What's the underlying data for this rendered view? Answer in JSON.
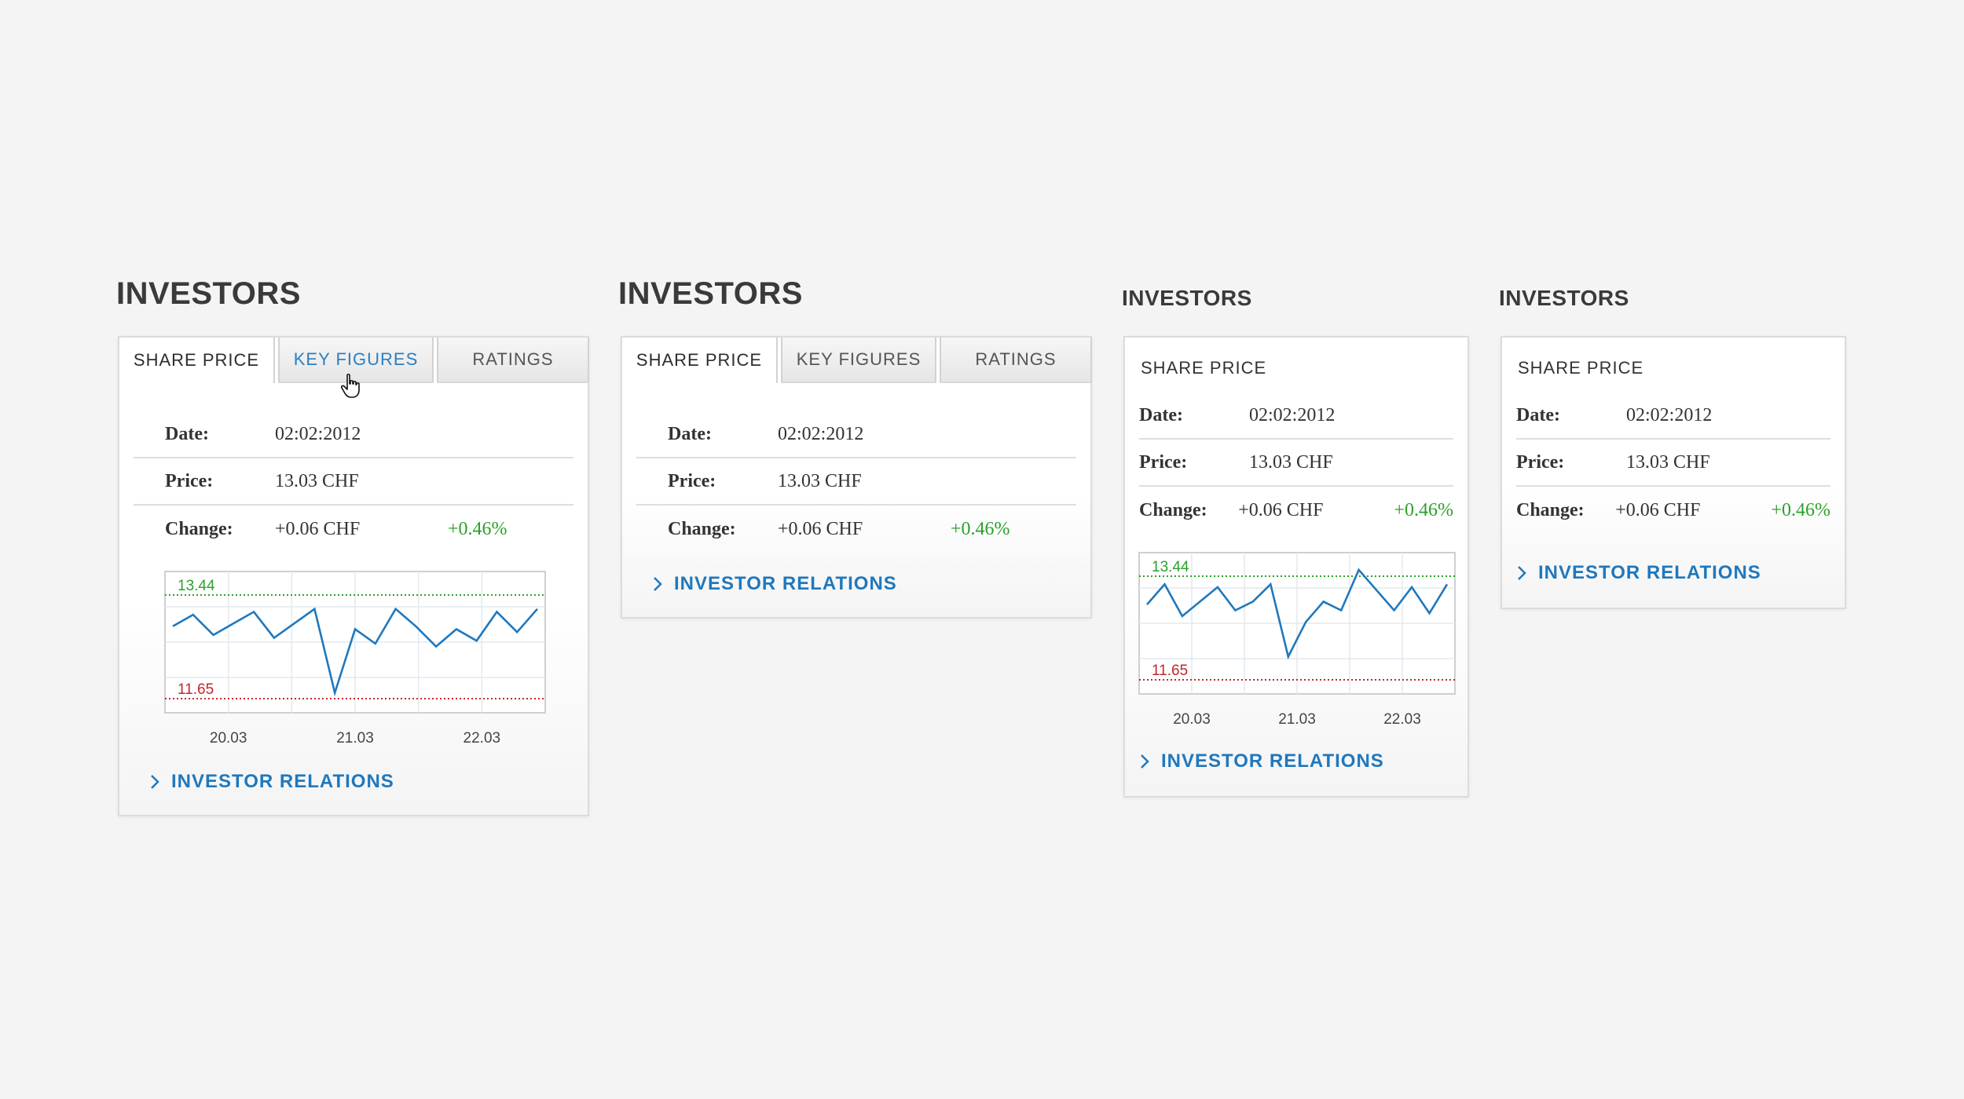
{
  "widgets": [
    {
      "heading": "INVESTORS",
      "tabs": [
        "SHARE PRICE",
        "KEY FIGURES",
        "RATINGS"
      ],
      "rows": [
        {
          "label": "Date:",
          "value": "02:02:2012"
        },
        {
          "label": "Price:",
          "value": "13.03 CHF"
        },
        {
          "label": "Change:",
          "value": "+0.06 CHF",
          "percent": "+0.46%"
        }
      ],
      "link": "INVESTOR RELATIONS"
    },
    {
      "heading": "INVESTORS",
      "tabs": [
        "SHARE PRICE",
        "KEY FIGURES",
        "RATINGS"
      ],
      "rows": [
        {
          "label": "Date:",
          "value": "02:02:2012"
        },
        {
          "label": "Price:",
          "value": "13.03 CHF"
        },
        {
          "label": "Change:",
          "value": "+0.06 CHF",
          "percent": "+0.46%"
        }
      ],
      "link": "INVESTOR RELATIONS"
    },
    {
      "heading": "INVESTORS",
      "title": "SHARE PRICE",
      "rows": [
        {
          "label": "Date:",
          "value": "02:02:2012"
        },
        {
          "label": "Price:",
          "value": "13.03 CHF"
        },
        {
          "label": "Change:",
          "value": "+0.06 CHF",
          "percent": "+0.46%"
        }
      ],
      "link": "INVESTOR RELATIONS"
    },
    {
      "heading": "INVESTORS",
      "title": "SHARE PRICE",
      "rows": [
        {
          "label": "Date:",
          "value": "02:02:2012"
        },
        {
          "label": "Price:",
          "value": "13.03 CHF"
        },
        {
          "label": "Change:",
          "value": "+0.06 CHF",
          "percent": "+0.46%"
        }
      ],
      "link": "INVESTOR RELATIONS"
    }
  ],
  "colors": {
    "link": "#1f78bd",
    "hover_tab": "#2b7fc2",
    "positive": "#2aa12a",
    "high_line": "#2aa12a",
    "low_line": "#c0272d",
    "price_line": "#1f78bd"
  },
  "icons": {
    "link_chevron": "chevron-right-icon",
    "cursor": "hand-pointer-icon"
  },
  "chart_data": [
    {
      "type": "line",
      "x_tick_labels": [
        "20.03",
        "21.03",
        "22.03"
      ],
      "high": 13.44,
      "low": 11.65,
      "series": [
        {
          "values": [
            12.9,
            13.1,
            12.75,
            12.95,
            13.15,
            12.7,
            12.95,
            13.2,
            11.75,
            12.85,
            12.6,
            13.2,
            12.9,
            12.55,
            12.85,
            12.65,
            13.15,
            12.8,
            13.2
          ]
        }
      ]
    },
    {
      "type": "line",
      "x_tick_labels": [
        "20.03",
        "21.03",
        "22.03"
      ],
      "high": 13.44,
      "low": 11.65,
      "series": [
        {
          "values": [
            12.95,
            13.3,
            12.75,
            13.0,
            13.25,
            12.85,
            13.0,
            13.3,
            12.05,
            12.65,
            13.0,
            12.85,
            13.55,
            13.2,
            12.85,
            13.25,
            12.8,
            13.3
          ]
        }
      ]
    }
  ]
}
